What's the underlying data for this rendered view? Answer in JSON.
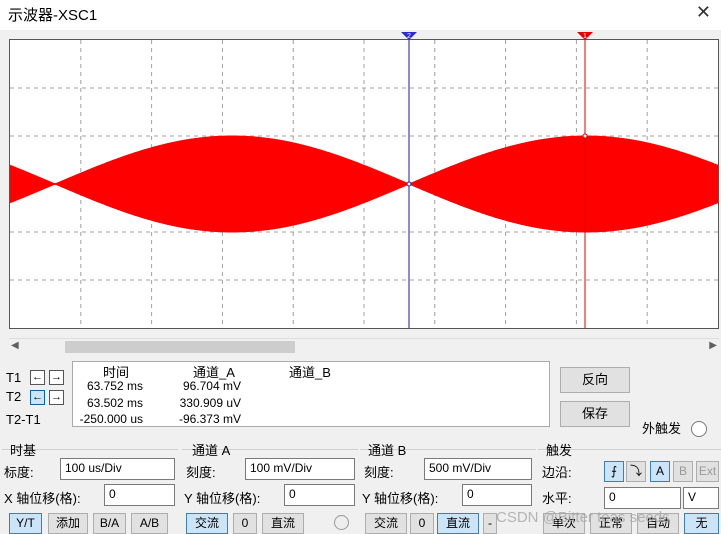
{
  "window": {
    "title": "示波器-XSC1"
  },
  "readout": {
    "headers": {
      "time": "时间",
      "ch_a": "通道_A",
      "ch_b": "通道_B"
    },
    "rows": [
      {
        "label": "T1",
        "time": "63.752 ms",
        "ch_a": "96.704 mV",
        "ch_b": ""
      },
      {
        "label": "T2",
        "time": "63.502 ms",
        "ch_a": "330.909 uV",
        "ch_b": ""
      },
      {
        "label": "T2-T1",
        "time": "-250.000 us",
        "ch_a": "-96.373 mV",
        "ch_b": ""
      }
    ]
  },
  "actions": {
    "reverse": "反向",
    "save": "保存",
    "ext_trigger": "外触发"
  },
  "timebase": {
    "title": "时基",
    "scale_label": "标度:",
    "scale_value": "100 us/Div",
    "xpos_label": "X 轴位移(格):",
    "xpos_value": "0",
    "modes": [
      "Y/T",
      "添加",
      "B/A",
      "A/B"
    ]
  },
  "channel_a": {
    "title": "通道 A",
    "scale_label": "刻度:",
    "scale_value": "100 mV/Div",
    "ypos_label": "Y 轴位移(格):",
    "ypos_value": "0",
    "coupling": [
      "交流",
      "0",
      "直流"
    ]
  },
  "channel_b": {
    "title": "通道 B",
    "scale_label": "刻度:",
    "scale_value": "500 mV/Div",
    "ypos_label": "Y 轴位移(格):",
    "ypos_value": "0",
    "coupling": [
      "交流",
      "0",
      "直流",
      "-"
    ]
  },
  "trigger": {
    "title": "触发",
    "edge_label": "边沿:",
    "edge_rise": "⨍",
    "edge_fall": "⤵",
    "sources": [
      "A",
      "B",
      "Ext"
    ],
    "level_label": "水平:",
    "level_value": "0",
    "level_unit": "V",
    "modes": [
      "单次",
      "正常",
      "自动",
      "无"
    ]
  },
  "watermark": "CSDN @Bitter teas   seeds",
  "colors": {
    "trace": "#ff0000",
    "cursor1": "#0000ff",
    "cursor2": "#ff0000",
    "grid": "#a0a0a0"
  }
}
